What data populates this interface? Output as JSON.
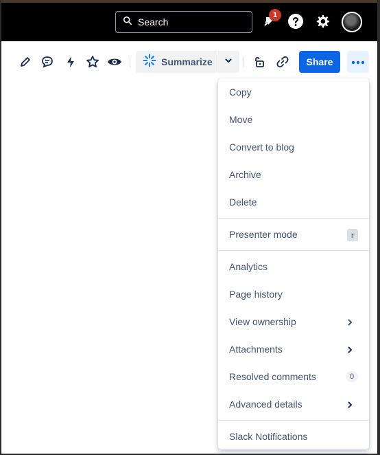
{
  "header": {
    "search_placeholder": "Search",
    "notification_count": "1"
  },
  "toolbar": {
    "summarize_label": "Summarize",
    "share_label": "Share"
  },
  "menu": {
    "group1": [
      "Copy",
      "Move",
      "Convert to blog",
      "Archive",
      "Delete"
    ],
    "presenter_label": "Presenter mode",
    "presenter_shortcut": "r",
    "analytics": "Analytics",
    "page_history": "Page history",
    "view_ownership": "View ownership",
    "attachments": "Attachments",
    "resolved_comments": "Resolved comments",
    "resolved_count": "0",
    "advanced_details": "Advanced details",
    "slack": "Slack Notifications"
  },
  "colors": {
    "accent": "#0c66e4",
    "badge": "#c9372c",
    "text": "#44546f"
  }
}
